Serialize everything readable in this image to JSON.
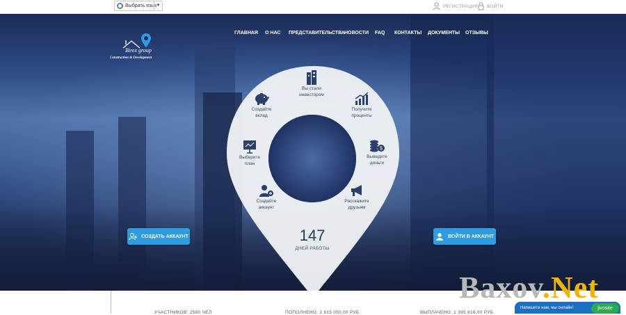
{
  "topbar": {
    "language_label": "Выбрать язык",
    "register_label": "РЕГИСТРАЦИЯ",
    "login_label": "ВОЙТИ"
  },
  "logo": {
    "name": "Birex group",
    "tagline": "Construction & Development"
  },
  "nav": [
    {
      "label": "ГЛАВНАЯ"
    },
    {
      "label": "О НАС"
    },
    {
      "label": "ПРЕДСТАВИТЕЛЬСТВА"
    },
    {
      "label": "НОВОСТИ"
    },
    {
      "label": "FAQ"
    },
    {
      "label": "КОНТАКТЫ"
    },
    {
      "label": "ДОКУМЕНТЫ"
    },
    {
      "label": "ОТЗЫВЫ"
    }
  ],
  "steps": [
    {
      "line1": "Вы стали",
      "line2": "инвестором",
      "icon": "building-icon"
    },
    {
      "line1": "Получите",
      "line2": "проценты",
      "icon": "growth-chart-icon"
    },
    {
      "line1": "Выведите",
      "line2": "деньги",
      "icon": "coins-icon"
    },
    {
      "line1": "Расскажите",
      "line2": "друзьям",
      "icon": "megaphone-icon"
    },
    {
      "line1": "Создайте",
      "line2": "аккаунт",
      "icon": "add-user-icon"
    },
    {
      "line1": "Выберите",
      "line2": "план",
      "icon": "presentation-icon"
    },
    {
      "line1": "Создайте",
      "line2": "вклад",
      "icon": "piggy-bank-icon"
    }
  ],
  "cta": {
    "create_account": "СОЗДАТЬ АККАУНТ",
    "login_account": "ВОЙТИ В АККАУНТ"
  },
  "counter": {
    "value": "147",
    "label": "ДНЕЙ РАБОТЫ"
  },
  "stats": {
    "participants": "УЧАСТНИКОВ: 2580 ЧЕЛ",
    "deposited": "ПОПОЛНЕНО: 2 815 050,00 РУБ",
    "paid": "ВЫПЛАЧЕНО: 1 395 816,00 РУБ"
  },
  "watermark": {
    "part1": "Baxov",
    "part2": ".Net"
  },
  "chat": {
    "prompt": "Напишите нам, мы онлайн!",
    "brand": "jivosite"
  },
  "colors": {
    "accent": "#2f9ce0",
    "hero_dark": "#1c2c56",
    "watermark_gray": "#b8b8b8",
    "watermark_orange": "#f0b400"
  }
}
